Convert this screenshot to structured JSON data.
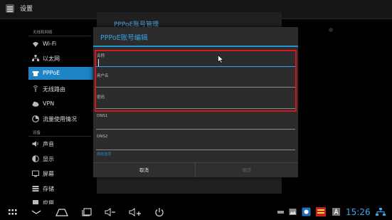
{
  "app": {
    "title": "设置",
    "icon": "settings-app-icon"
  },
  "sidebar": {
    "sections": [
      {
        "header": "无线和网络"
      },
      {
        "header": "设备"
      }
    ],
    "items": [
      {
        "label": "Wi-Fi",
        "icon": "wifi-icon"
      },
      {
        "label": "以太网",
        "icon": "ethernet-icon"
      },
      {
        "label": "PPPoE",
        "icon": "phone-icon",
        "selected": true
      },
      {
        "label": "无线路由",
        "icon": "router-icon"
      },
      {
        "label": "VPN",
        "icon": "cloud-icon"
      },
      {
        "label": "流量使用情况",
        "icon": "data-usage-icon"
      },
      {
        "label": "声音",
        "icon": "volume-icon"
      },
      {
        "label": "显示",
        "icon": "display-icon"
      },
      {
        "label": "屏幕",
        "icon": "screen-icon"
      },
      {
        "label": "存储",
        "icon": "storage-icon"
      },
      {
        "label": "应用",
        "icon": "apps-icon"
      }
    ]
  },
  "background_pane": {
    "title": "PPPoE账号管理"
  },
  "dialog": {
    "title": "PPPoE账号编辑",
    "fields": [
      {
        "label": "名称",
        "value": ""
      },
      {
        "label": "用户名",
        "value": ""
      },
      {
        "label": "密码",
        "value": ""
      },
      {
        "label": "DNS1",
        "value": ""
      },
      {
        "label": "DNS2",
        "value": ""
      }
    ],
    "advanced_label": "高级选项",
    "cancel_label": "取消",
    "ok_label": "确定"
  },
  "statusbar": {
    "time": "15:26"
  },
  "colors": {
    "accent": "#1e84c6",
    "highlight": "#d7131b",
    "background": "#000000"
  }
}
